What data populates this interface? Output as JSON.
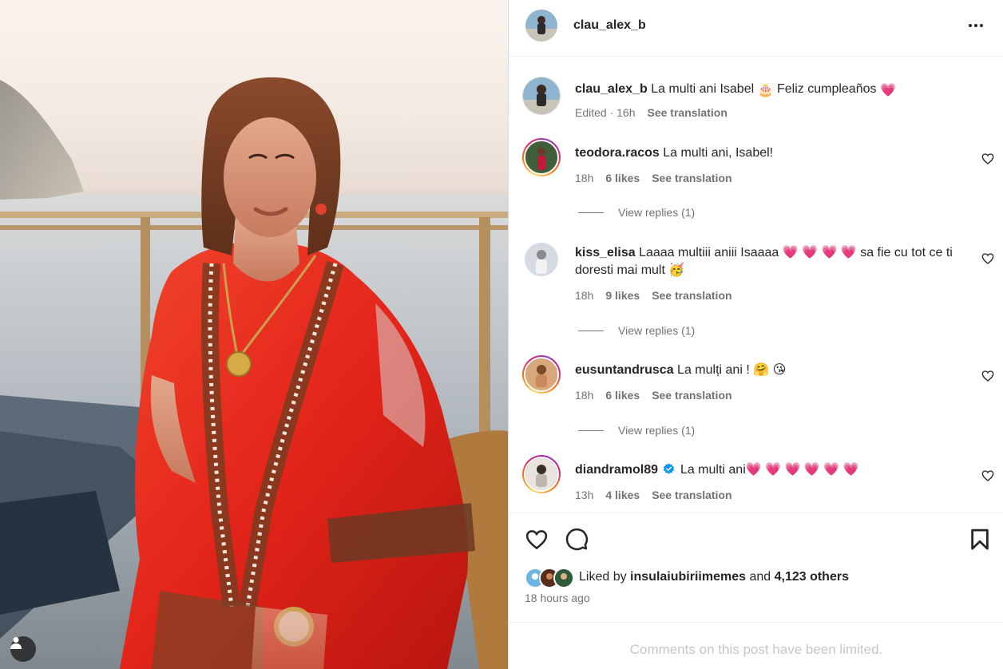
{
  "post": {
    "author": "clau_alex_b",
    "more_icon": "more-horizontal-icon"
  },
  "caption": {
    "author": "clau_alex_b",
    "text_part1": "La multi ani Isabel",
    "cake_emoji": "🎂",
    "text_part2": "Feliz cumpleaños",
    "heart_emoji": "💗",
    "edited": "Edited · 16h",
    "see_translation": "See translation"
  },
  "comments": [
    {
      "username": "teodora.racos",
      "text": "La multi ani, Isabel!",
      "time": "18h",
      "likes": "6 likes",
      "see_translation": "See translation",
      "view_replies": "View replies (1)"
    },
    {
      "username": "kiss_elisa",
      "text": "Laaaa multiii aniii Isaaaa 💗 💗 💗 💗  sa fie cu tot ce ti doresti mai mult 🥳",
      "time": "18h",
      "likes": "9 likes",
      "see_translation": "See translation",
      "view_replies": "View replies (1)"
    },
    {
      "username": "eusuntandrusca",
      "text": "La mulți ani ! 🤗 😘",
      "time": "18h",
      "likes": "6 likes",
      "see_translation": "See translation",
      "view_replies": "View replies (1)"
    },
    {
      "username": "diandramol89",
      "verified": true,
      "text": "La multi ani💗 💗 💗 💗 💗 💗",
      "time": "13h",
      "likes": "4 likes",
      "see_translation": "See translation"
    }
  ],
  "actions": {
    "like_icon": "heart-outline-icon",
    "comment_icon": "comment-bubble-icon",
    "save_icon": "bookmark-icon"
  },
  "likes": {
    "prefix": "Liked by",
    "user": "insulaiubiriimemes",
    "and": "and",
    "others": "4,123 others"
  },
  "time_ago": "18 hours ago",
  "comments_limited": "Comments on this post have been limited.",
  "colors": {
    "text": "#262626",
    "secondary": "#737373",
    "heart": "#e0245e",
    "verified": "#0095f6",
    "muted": "#c7c7c7"
  }
}
